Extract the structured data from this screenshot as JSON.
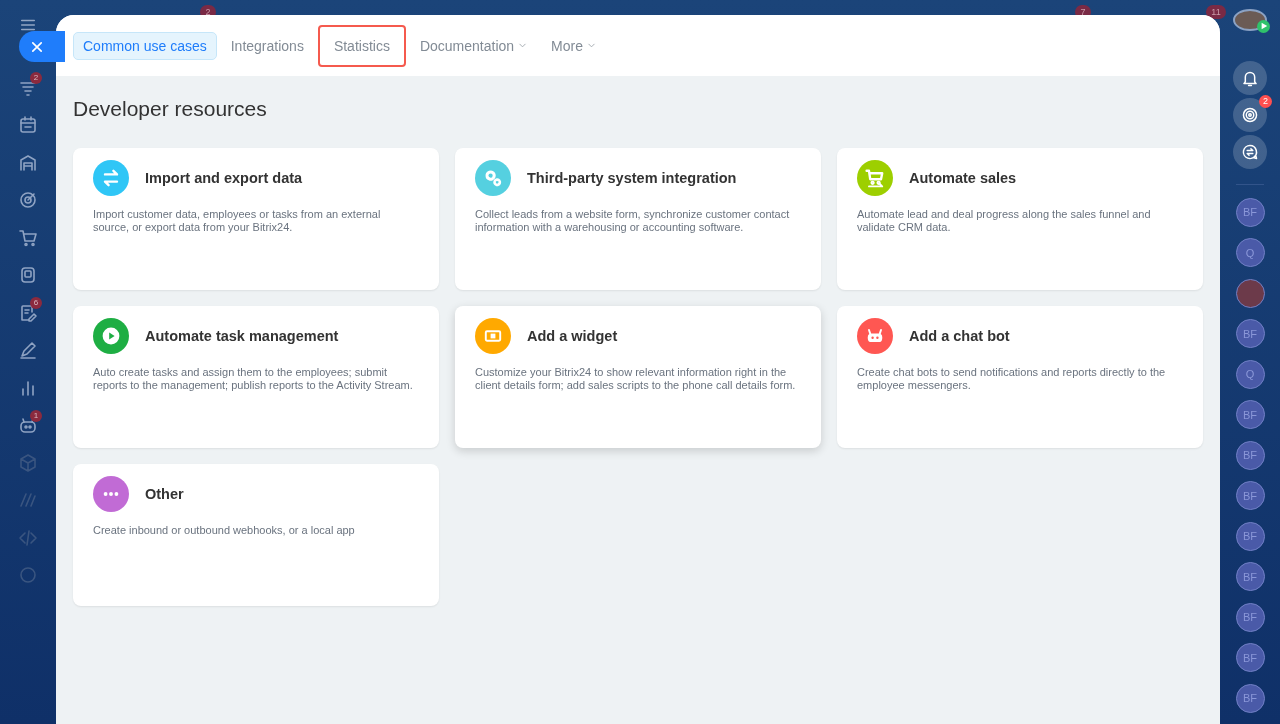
{
  "top_badges": [
    {
      "text": "2"
    },
    {
      "text": "7"
    },
    {
      "text": "11"
    }
  ],
  "left_sidebar": {
    "items": [
      {
        "badge": "2",
        "dim": false
      },
      {
        "dim": false
      },
      {
        "dim": false
      },
      {
        "dim": false
      },
      {
        "dim": false
      },
      {
        "dim": false
      },
      {
        "badge": "6",
        "dim": false
      },
      {
        "dim": false
      },
      {
        "dim": false
      },
      {
        "badge": "1",
        "dim": false
      },
      {
        "dim": true
      },
      {
        "dim": true
      },
      {
        "dim": true
      },
      {
        "dim": true
      }
    ]
  },
  "tabs": [
    {
      "label": "Common use cases",
      "selected": true,
      "highlighted": false,
      "has_menu": false
    },
    {
      "label": "Integrations",
      "selected": false,
      "highlighted": false,
      "has_menu": false
    },
    {
      "label": "Statistics",
      "selected": false,
      "highlighted": true,
      "has_menu": false
    },
    {
      "label": "Documentation",
      "selected": false,
      "highlighted": false,
      "has_menu": true
    },
    {
      "label": "More",
      "selected": false,
      "highlighted": false,
      "has_menu": true
    }
  ],
  "page_title": "Developer resources",
  "cards": [
    {
      "title": "Import and export data",
      "description": "Import customer data, employees or tasks from an external source, or export data from your Bitrix24.",
      "color": "#2fc6f6",
      "raised": false
    },
    {
      "title": "Third-party system integration",
      "description": "Collect leads from a website form, synchronize customer contact information with a warehousing or accounting software.",
      "color": "#55d0e0",
      "raised": false
    },
    {
      "title": "Automate sales",
      "description": "Automate lead and deal progress along the sales funnel and validate CRM data.",
      "color": "#9dcf00",
      "raised": false
    },
    {
      "title": "Automate task management",
      "description": "Auto create tasks and assign them to the employees; submit reports to the management; publish reports to the Activity Stream.",
      "color": "#1eae43",
      "raised": false
    },
    {
      "title": "Add a widget",
      "description": "Customize your Bitrix24 to show relevant information right in the client details form; add sales scripts to the phone call details form.",
      "color": "#ffa900",
      "raised": true
    },
    {
      "title": "Add a chat bot",
      "description": "Create chat bots to send notifications and reports directly to the employee messengers.",
      "color": "#ff5752",
      "raised": false
    },
    {
      "title": "Other",
      "description": "Create inbound or outbound webhooks, or a local app",
      "color": "#c16bd5",
      "raised": false
    }
  ],
  "right_sidebar": {
    "tools": [
      {
        "kind": "bell"
      },
      {
        "kind": "swirl",
        "badge": "2"
      },
      {
        "kind": "chat"
      }
    ],
    "contacts": [
      {
        "kind": "initials",
        "text": "BF"
      },
      {
        "kind": "initials",
        "text": "Q"
      },
      {
        "kind": "photo"
      },
      {
        "kind": "initials",
        "text": "BF"
      },
      {
        "kind": "initials",
        "text": "Q"
      },
      {
        "kind": "initials",
        "text": "BF"
      },
      {
        "kind": "initials",
        "text": "BF"
      },
      {
        "kind": "initials",
        "text": "BF"
      },
      {
        "kind": "initials",
        "text": "BF"
      },
      {
        "kind": "initials",
        "text": "BF"
      },
      {
        "kind": "initials",
        "text": "BF"
      },
      {
        "kind": "initials",
        "text": "BF"
      },
      {
        "kind": "initials",
        "text": "BF"
      }
    ]
  }
}
